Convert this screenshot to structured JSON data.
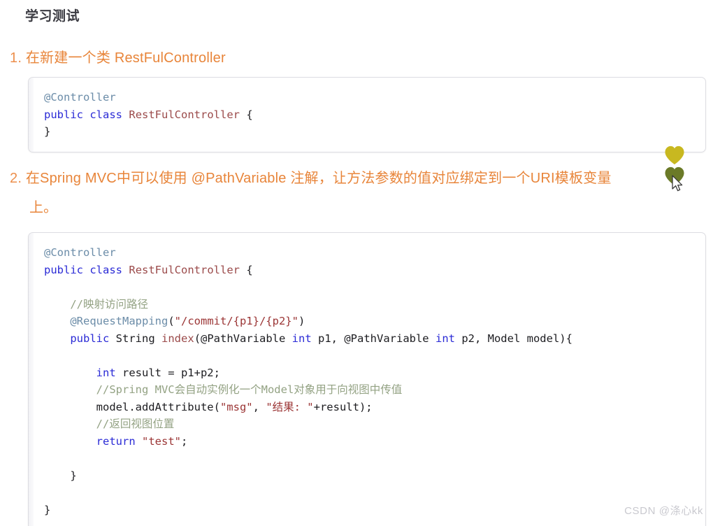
{
  "page": {
    "title": "学习测试",
    "watermark": "CSDN @涤心kk"
  },
  "list": {
    "items": [
      {
        "marker": "1.",
        "text": "在新建一个类 RestFulController"
      },
      {
        "marker": "2.",
        "text": "在Spring MVC中可以使用 @PathVariable 注解，让方法参数的值对应绑定到一个URI模板变量",
        "text_line2": "上。"
      }
    ]
  },
  "code_blocks": [
    {
      "id": "code-block-1",
      "language": "java",
      "lines": [
        [
          {
            "t": "@Controller",
            "c": "tok-anno"
          }
        ],
        [
          {
            "t": "public",
            "c": "tok-kw"
          },
          {
            "t": " ",
            "c": "tok-plain"
          },
          {
            "t": "class",
            "c": "tok-kw"
          },
          {
            "t": " ",
            "c": "tok-plain"
          },
          {
            "t": "RestFulController",
            "c": "tok-cls"
          },
          {
            "t": " {",
            "c": "tok-plain"
          }
        ],
        [
          {
            "t": "}",
            "c": "tok-plain"
          }
        ]
      ]
    },
    {
      "id": "code-block-2",
      "language": "java",
      "lines": [
        [
          {
            "t": "@Controller",
            "c": "tok-anno"
          }
        ],
        [
          {
            "t": "public",
            "c": "tok-kw"
          },
          {
            "t": " ",
            "c": "tok-plain"
          },
          {
            "t": "class",
            "c": "tok-kw"
          },
          {
            "t": " ",
            "c": "tok-plain"
          },
          {
            "t": "RestFulController",
            "c": "tok-cls"
          },
          {
            "t": " {",
            "c": "tok-plain"
          }
        ],
        [
          {
            "t": "",
            "c": "tok-plain"
          }
        ],
        [
          {
            "t": "    //映射访问路径",
            "c": "tok-cmt"
          }
        ],
        [
          {
            "t": "    ",
            "c": "tok-plain"
          },
          {
            "t": "@RequestMapping",
            "c": "tok-anno"
          },
          {
            "t": "(",
            "c": "tok-plain"
          },
          {
            "t": "\"/commit/{p1}/{p2}\"",
            "c": "tok-str"
          },
          {
            "t": ")",
            "c": "tok-plain"
          }
        ],
        [
          {
            "t": "    ",
            "c": "tok-plain"
          },
          {
            "t": "public",
            "c": "tok-kw"
          },
          {
            "t": " ",
            "c": "tok-plain"
          },
          {
            "t": "String",
            "c": "tok-plain"
          },
          {
            "t": " ",
            "c": "tok-plain"
          },
          {
            "t": "index",
            "c": "tok-cls"
          },
          {
            "t": "(@PathVariable ",
            "c": "tok-plain"
          },
          {
            "t": "int",
            "c": "tok-type"
          },
          {
            "t": " p1, @PathVariable ",
            "c": "tok-plain"
          },
          {
            "t": "int",
            "c": "tok-type"
          },
          {
            "t": " p2, Model model){",
            "c": "tok-plain"
          }
        ],
        [
          {
            "t": "",
            "c": "tok-plain"
          }
        ],
        [
          {
            "t": "        ",
            "c": "tok-plain"
          },
          {
            "t": "int",
            "c": "tok-type"
          },
          {
            "t": " result = p1+p2;",
            "c": "tok-plain"
          }
        ],
        [
          {
            "t": "        //Spring MVC会自动实例化一个Model对象用于向视图中传值",
            "c": "tok-cmt"
          }
        ],
        [
          {
            "t": "        model.addAttribute(",
            "c": "tok-plain"
          },
          {
            "t": "\"msg\"",
            "c": "tok-str"
          },
          {
            "t": ", ",
            "c": "tok-plain"
          },
          {
            "t": "\"结果: \"",
            "c": "tok-str"
          },
          {
            "t": "+result);",
            "c": "tok-plain"
          }
        ],
        [
          {
            "t": "        //返回视图位置",
            "c": "tok-cmt"
          }
        ],
        [
          {
            "t": "        ",
            "c": "tok-plain"
          },
          {
            "t": "return",
            "c": "tok-kw"
          },
          {
            "t": " ",
            "c": "tok-plain"
          },
          {
            "t": "\"test\"",
            "c": "tok-str"
          },
          {
            "t": ";",
            "c": "tok-plain"
          }
        ],
        [
          {
            "t": "",
            "c": "tok-plain"
          }
        ],
        [
          {
            "t": "    }",
            "c": "tok-plain"
          }
        ],
        [
          {
            "t": "",
            "c": "tok-plain"
          }
        ],
        [
          {
            "t": "}",
            "c": "tok-plain"
          }
        ]
      ]
    }
  ],
  "reactions": [
    {
      "name": "heart-reaction-top",
      "color": "#c8b820"
    },
    {
      "name": "heart-reaction-bottom",
      "color": "#6b7a28"
    }
  ],
  "colors": {
    "accent_orange": "#e8853a",
    "marker_orange": "#ec8f4c",
    "title_gray": "#3b3b42",
    "code_border": "#dddde2",
    "watermark_gray": "#c9c9cf"
  }
}
